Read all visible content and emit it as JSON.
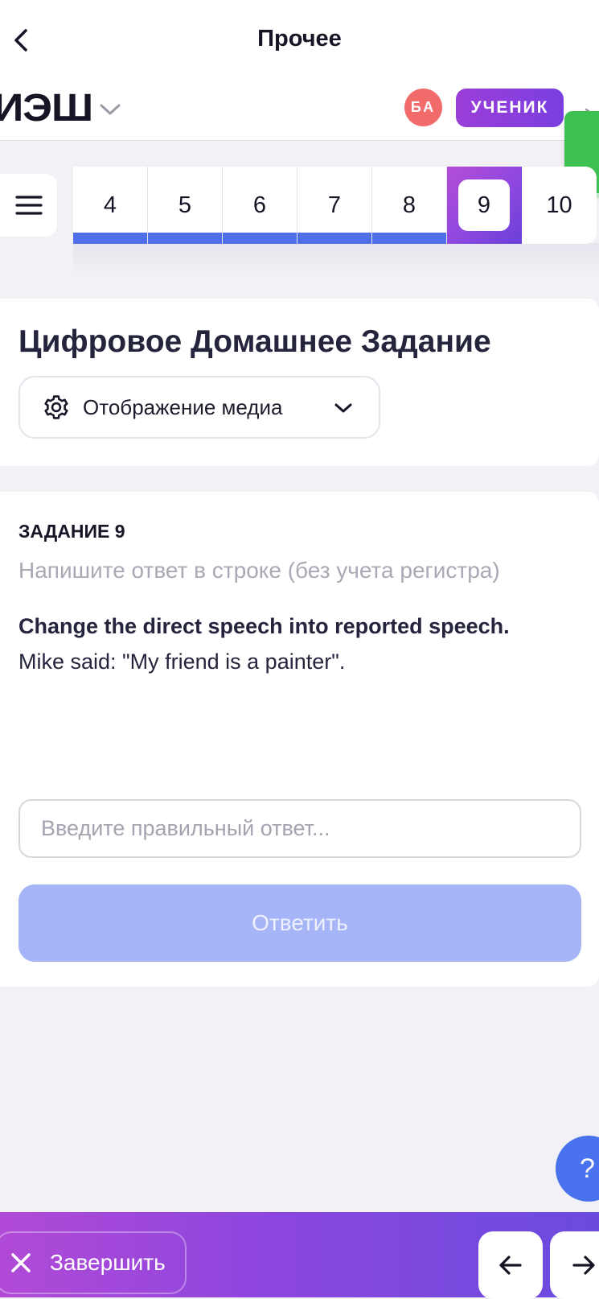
{
  "header": {
    "title": "Прочее"
  },
  "brand": {
    "logo": "ИЭШ",
    "avatar_initials": "БА",
    "role": "УЧЕНИК"
  },
  "question_nav": {
    "items": [
      {
        "label": "4",
        "state": "done"
      },
      {
        "label": "5",
        "state": "done"
      },
      {
        "label": "6",
        "state": "done"
      },
      {
        "label": "7",
        "state": "done"
      },
      {
        "label": "8",
        "state": "done"
      },
      {
        "label": "9",
        "state": "active"
      },
      {
        "label": "10",
        "state": "pending"
      }
    ]
  },
  "card": {
    "title": "Цифровое Домашнее Задание",
    "media_dropdown": "Отображение медиа"
  },
  "task": {
    "title": "ЗАДАНИЕ 9",
    "hint": "Напишите ответ в строке (без учета регистра)",
    "question": "Change the direct speech into reported speech.",
    "text": "Mike said: \"My friend is a painter\".",
    "input_placeholder": "Введите правильный ответ...",
    "input_value": "",
    "submit_label": "Ответить"
  },
  "help": {
    "label": "?"
  },
  "footer": {
    "finish_label": "Завершить"
  },
  "colors": {
    "accent_purple": "#8e48e0",
    "progress_blue": "#4f6fe8",
    "submit_disabled": "#a5b5f7",
    "avatar_red": "#f26b6b",
    "green_tab": "#3ec052"
  }
}
